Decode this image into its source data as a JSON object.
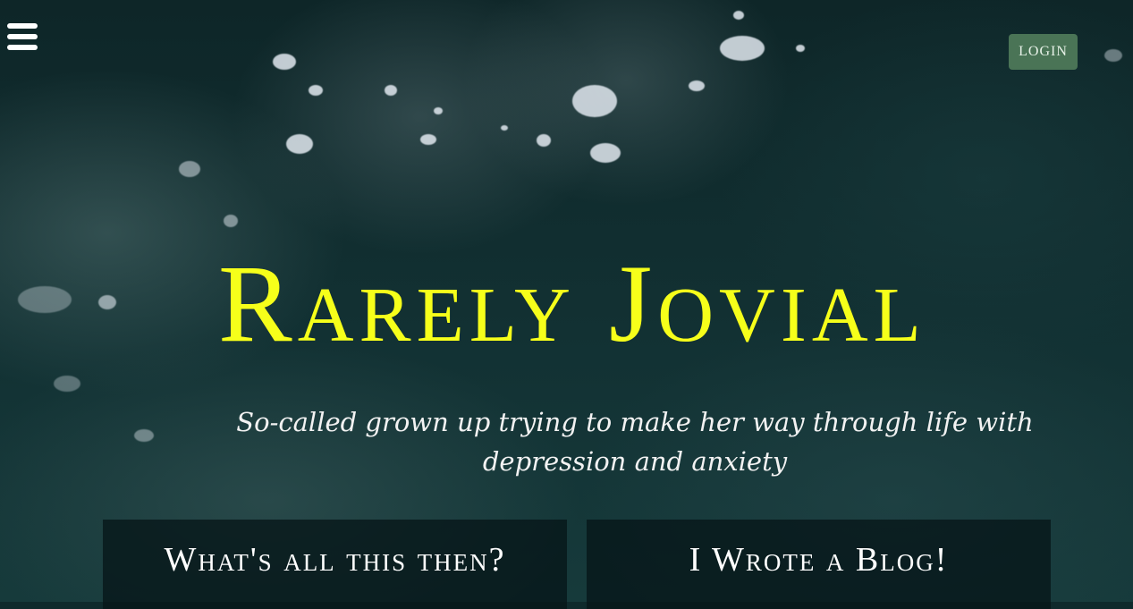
{
  "header": {
    "menu_icon": "hamburger-menu-icon",
    "login_label": "Login",
    "login_color": "#4a7456"
  },
  "hero": {
    "title": "Rarely Jovial",
    "title_color": "#f6ff1a",
    "tagline": "So-called grown up trying to make her way through life with depression and anxiety"
  },
  "cards": [
    {
      "label": "What's all this then?"
    },
    {
      "label": "I Wrote a Blog!"
    }
  ]
}
